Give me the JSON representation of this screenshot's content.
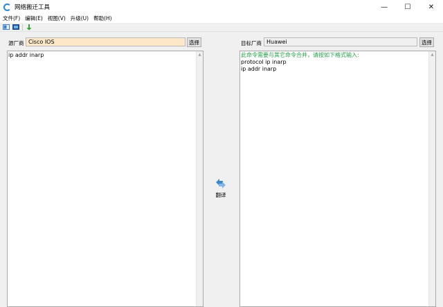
{
  "window": {
    "title": "网络搬迁工具",
    "minimize_glyph": "—",
    "maximize_glyph": "☐",
    "close_glyph": "✕"
  },
  "menu": {
    "items": [
      "文件(F)",
      "编辑(E)",
      "视图(V)",
      "升级(U)",
      "帮助(H)"
    ]
  },
  "toolbar": {
    "icons": [
      "window-left-icon",
      "window-right-icon",
      "download-arrow-icon"
    ]
  },
  "source": {
    "label": "源厂商",
    "vendor": "Cisco IOS",
    "pick_label": "选择",
    "lines": [
      "ip addr inarp"
    ]
  },
  "target": {
    "label": "目标厂商",
    "vendor": "Huawei",
    "pick_label": "选择",
    "note": "此命令需要与其它命令合并，请按如下格式输入:",
    "lines": [
      "protocol ip inarp",
      "ip addr inarp"
    ]
  },
  "translate": {
    "label": "翻译",
    "icon": "translate-arrows-icon"
  },
  "colors": {
    "source_field_bg": "#fce7c9",
    "note_text": "#22a046",
    "accent": "#2b83d6"
  }
}
